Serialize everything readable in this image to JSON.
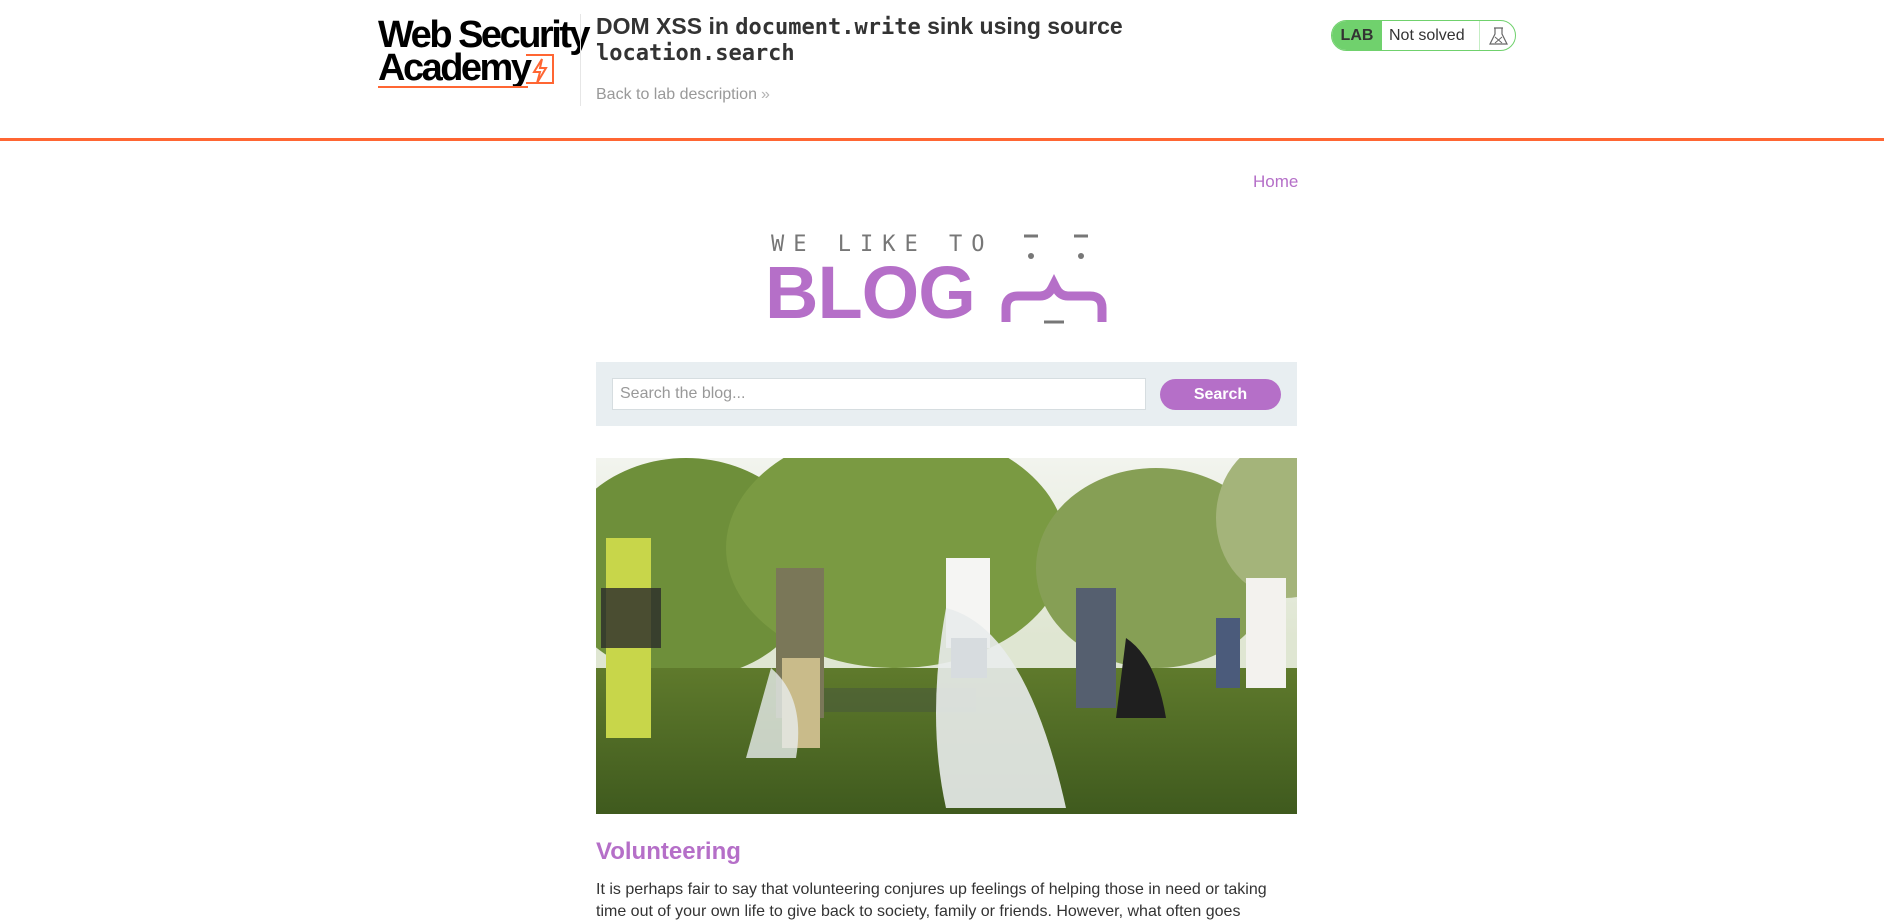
{
  "header": {
    "logo": {
      "line1": "Web Security",
      "line2": "Academy"
    },
    "lab_title_prefix": "DOM XSS in ",
    "lab_title_code1": "document.write",
    "lab_title_mid": " sink using source",
    "lab_title_code2": "location.search",
    "back_link": "Back to lab description",
    "status": {
      "tag": "LAB",
      "text": "Not solved",
      "icon": "flask-icon"
    }
  },
  "nav": {
    "home": "Home"
  },
  "banner": {
    "top": "WE LIKE TO",
    "big": "BLOG"
  },
  "search": {
    "placeholder": "Search the blog...",
    "button": "Search"
  },
  "post": {
    "title": "Volunteering",
    "excerpt": "It is perhaps fair to say that volunteering conjures up feelings of helping those in need or taking time out of your own life to give back to society, family or friends. However, what often goes"
  },
  "colors": {
    "accent": "#b56fc8",
    "brand_orange": "#ff6633",
    "status_green": "#70d16d"
  }
}
